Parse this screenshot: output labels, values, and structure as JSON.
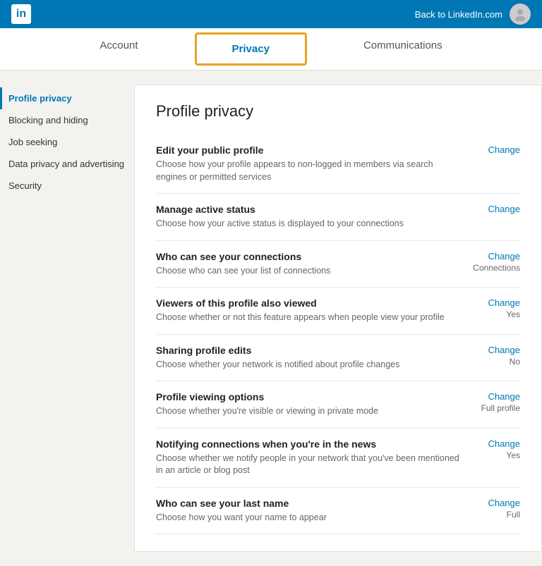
{
  "topbar": {
    "back_label": "Back to LinkedIn.com",
    "logo_text": "in"
  },
  "nav": {
    "tabs": [
      {
        "id": "account",
        "label": "Account",
        "active": false
      },
      {
        "id": "privacy",
        "label": "Privacy",
        "active": true
      },
      {
        "id": "communications",
        "label": "Communications",
        "active": false
      }
    ]
  },
  "sidebar": {
    "items": [
      {
        "id": "profile-privacy",
        "label": "Profile privacy",
        "active": true
      },
      {
        "id": "blocking-hiding",
        "label": "Blocking and hiding",
        "active": false
      },
      {
        "id": "job-seeking",
        "label": "Job seeking",
        "active": false
      },
      {
        "id": "data-privacy",
        "label": "Data privacy and advertising",
        "active": false
      },
      {
        "id": "security",
        "label": "Security",
        "active": false
      }
    ]
  },
  "content": {
    "title": "Profile privacy",
    "settings": [
      {
        "id": "edit-public-profile",
        "title": "Edit your public profile",
        "desc": "Choose how your profile appears to non-logged in members via search engines or permitted services",
        "change_label": "Change",
        "value": ""
      },
      {
        "id": "manage-active-status",
        "title": "Manage active status",
        "desc": "Choose how your active status is displayed to your connections",
        "change_label": "Change",
        "value": ""
      },
      {
        "id": "who-can-see-connections",
        "title": "Who can see your connections",
        "desc": "Choose who can see your list of connections",
        "change_label": "Change",
        "value": "Connections"
      },
      {
        "id": "viewers-also-viewed",
        "title": "Viewers of this profile also viewed",
        "desc": "Choose whether or not this feature appears when people view your profile",
        "change_label": "Change",
        "value": "Yes"
      },
      {
        "id": "sharing-profile-edits",
        "title": "Sharing profile edits",
        "desc": "Choose whether your network is notified about profile changes",
        "change_label": "Change",
        "value": "No"
      },
      {
        "id": "profile-viewing-options",
        "title": "Profile viewing options",
        "desc": "Choose whether you're visible or viewing in private mode",
        "change_label": "Change",
        "value": "Full profile"
      },
      {
        "id": "notifying-connections",
        "title": "Notifying connections when you're in the news",
        "desc": "Choose whether we notify people in your network that you've been mentioned in an article or blog post",
        "change_label": "Change",
        "value": "Yes"
      },
      {
        "id": "who-can-see-last-name",
        "title": "Who can see your last name",
        "desc": "Choose how you want your name to appear",
        "change_label": "Change",
        "value": "Full"
      }
    ]
  }
}
